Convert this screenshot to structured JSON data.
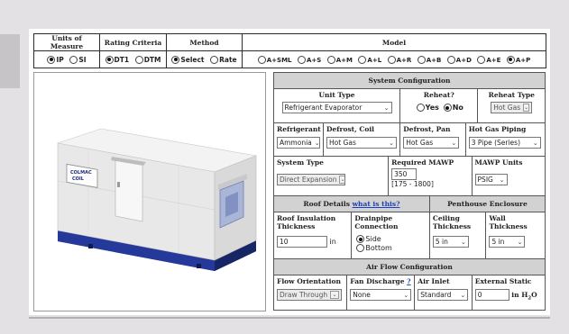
{
  "top_table": {
    "headers": {
      "units": "Units of Measure",
      "rating": "Rating Criteria",
      "method": "Method",
      "model": "Model"
    },
    "units_options": [
      {
        "label": "IP",
        "selected": true
      },
      {
        "label": "SI",
        "selected": false
      }
    ],
    "rating_options": [
      {
        "label": "DT1",
        "selected": true
      },
      {
        "label": "DTM",
        "selected": false
      }
    ],
    "method_options": [
      {
        "label": "Select",
        "selected": true
      },
      {
        "label": "Rate",
        "selected": false
      }
    ],
    "model_options": [
      {
        "label": "A+SML",
        "selected": false
      },
      {
        "label": "A+S",
        "selected": false
      },
      {
        "label": "A+M",
        "selected": false
      },
      {
        "label": "A+L",
        "selected": false
      },
      {
        "label": "A+R",
        "selected": false
      },
      {
        "label": "A+B",
        "selected": false
      },
      {
        "label": "A+D",
        "selected": false
      },
      {
        "label": "A+E",
        "selected": false
      },
      {
        "label": "A+P",
        "selected": true
      }
    ]
  },
  "image": {
    "badge_line1": "COLMAC",
    "badge_line2": "COIL"
  },
  "sys": {
    "title": "System Configuration",
    "unit_type": {
      "label": "Unit Type",
      "value": "Refrigerant Evaporator"
    },
    "reheat": {
      "label": "Reheat?",
      "yes": "Yes",
      "no": "No",
      "selected": "No"
    },
    "reheat_type": {
      "label": "Reheat Type",
      "value": "Hot Gas"
    },
    "refrigerant": {
      "label": "Refrigerant",
      "value": "Ammonia"
    },
    "defrost_coil": {
      "label": "Defrost, Coil",
      "value": "Hot Gas"
    },
    "defrost_pan": {
      "label": "Defrost, Pan",
      "value": "Hot Gas"
    },
    "hot_gas_piping": {
      "label": "Hot Gas Piping",
      "value": "3 Pipe (Series)"
    },
    "system_type": {
      "label": "System Type",
      "value": "Direct Expansion"
    },
    "required_mawp": {
      "label": "Required MAWP",
      "value": "350",
      "range": "[175 - 1800]"
    },
    "mawp_units": {
      "label": "MAWP Units",
      "value": "PSIG"
    },
    "roof_details": {
      "title": "Roof Details",
      "link": "what is this?"
    },
    "penthouse": {
      "title": "Penthouse Enclosure"
    },
    "roof_insulation": {
      "label": "Roof Insulation Thickness",
      "value": "10",
      "unit": "in"
    },
    "drainpipe": {
      "label": "Drainpipe Connection",
      "side": "Side",
      "bottom": "Bottom",
      "selected": "Side"
    },
    "ceiling": {
      "label": "Ceiling Thickness",
      "value": "5 in"
    },
    "wall": {
      "label": "Wall Thickness",
      "value": "5 in"
    },
    "airflow": {
      "title": "Air Flow Configuration",
      "fan_orientation": {
        "label": "Flow Orientation",
        "value": "Draw Through"
      },
      "fan_discharge": {
        "label": "Fan Discharge",
        "help": "?",
        "value": "None"
      },
      "air_inlet": {
        "label": "Air Inlet",
        "value": "Standard"
      },
      "external_static": {
        "label": "External Static",
        "value": "0",
        "unit_prefix": "in H",
        "unit_sub": "2",
        "unit_suffix": "O"
      }
    }
  }
}
